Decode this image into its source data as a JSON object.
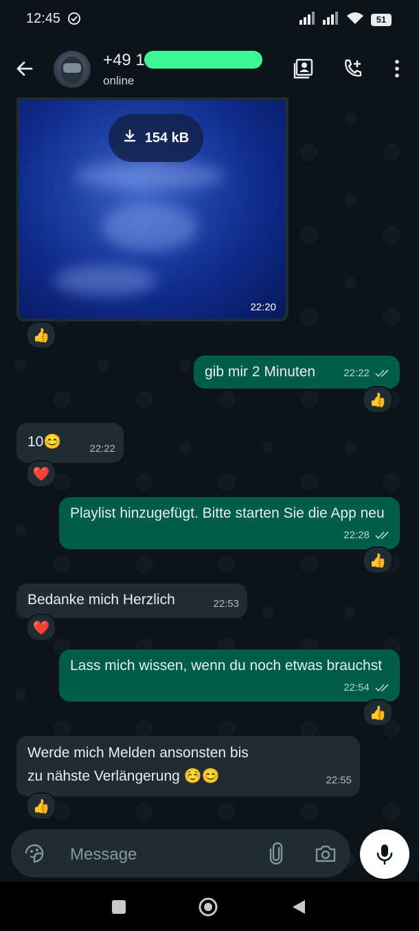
{
  "status_bar": {
    "time": "12:45",
    "battery": "51"
  },
  "header": {
    "name": "+49 1",
    "status": "online"
  },
  "messages": [
    {
      "direction": "in",
      "type": "media",
      "size": "154 kB",
      "time": "22:20",
      "reaction": "👍"
    },
    {
      "direction": "out",
      "text": "gib mir 2 Minuten",
      "time": "22:22",
      "reaction": "👍"
    },
    {
      "direction": "in",
      "text": "10😊",
      "time": "22:22",
      "reaction": "❤️"
    },
    {
      "direction": "out",
      "text": "Playlist hinzugefügt. Bitte starten Sie die App neu",
      "time": "22:28",
      "reaction": "👍"
    },
    {
      "direction": "in",
      "text": "Bedanke mich Herzlich",
      "time": "22:53",
      "reaction": "❤️"
    },
    {
      "direction": "out",
      "text": "Lass mich wissen, wenn du noch etwas brauchst",
      "time": "22:54",
      "reaction": "👍"
    },
    {
      "direction": "in",
      "text": "Werde mich Melden ansonsten bis zu nähste Verlängerung ☺️😊",
      "time": "22:55",
      "reaction": "👍"
    }
  ],
  "composer": {
    "placeholder": "Message"
  },
  "icons": {
    "back": "arrow-left-icon",
    "contact_card": "contact-card-icon",
    "add_call": "phone-plus-icon",
    "menu": "more-vertical-icon",
    "sticker": "sticker-icon",
    "attach": "paperclip-icon",
    "camera": "camera-icon",
    "mic": "microphone-icon"
  },
  "colors": {
    "background": "#0b141a",
    "incoming_bubble": "#202c33",
    "outgoing_bubble": "#005c4b",
    "accent_redaction": "#3cf792"
  }
}
